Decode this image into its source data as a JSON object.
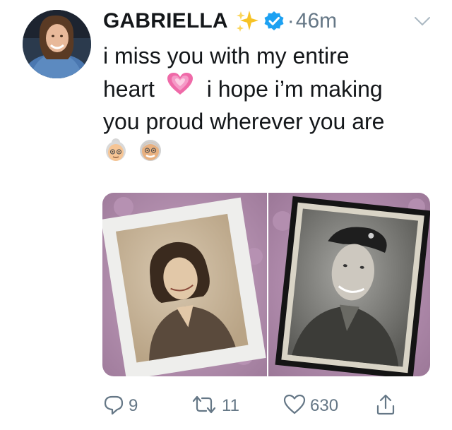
{
  "tweet": {
    "author": {
      "display_name": "GABRIELLA",
      "name_emoji": "sparkles",
      "verified": true
    },
    "timestamp_prefix": "·",
    "timestamp": "46m",
    "text_lines": [
      "i miss you with my entire",
      "heart",
      "i hope i’m making",
      "you proud wherever you are"
    ],
    "inline_emojis": [
      "growing-heart-emoji",
      "old-woman-emoji",
      "old-man-emoji"
    ],
    "photos": [
      {
        "description_name": "framed-portrait-woman"
      },
      {
        "description_name": "framed-portrait-soldier"
      }
    ]
  },
  "actions": {
    "reply_count": "9",
    "retweet_count": "11",
    "like_count": "630"
  },
  "colors": {
    "text": "#14171a",
    "muted": "#657786",
    "verified_blue": "#1da1f2",
    "sparkle_yellow": "#f7c325",
    "heart_pink": "#f17bb0"
  }
}
